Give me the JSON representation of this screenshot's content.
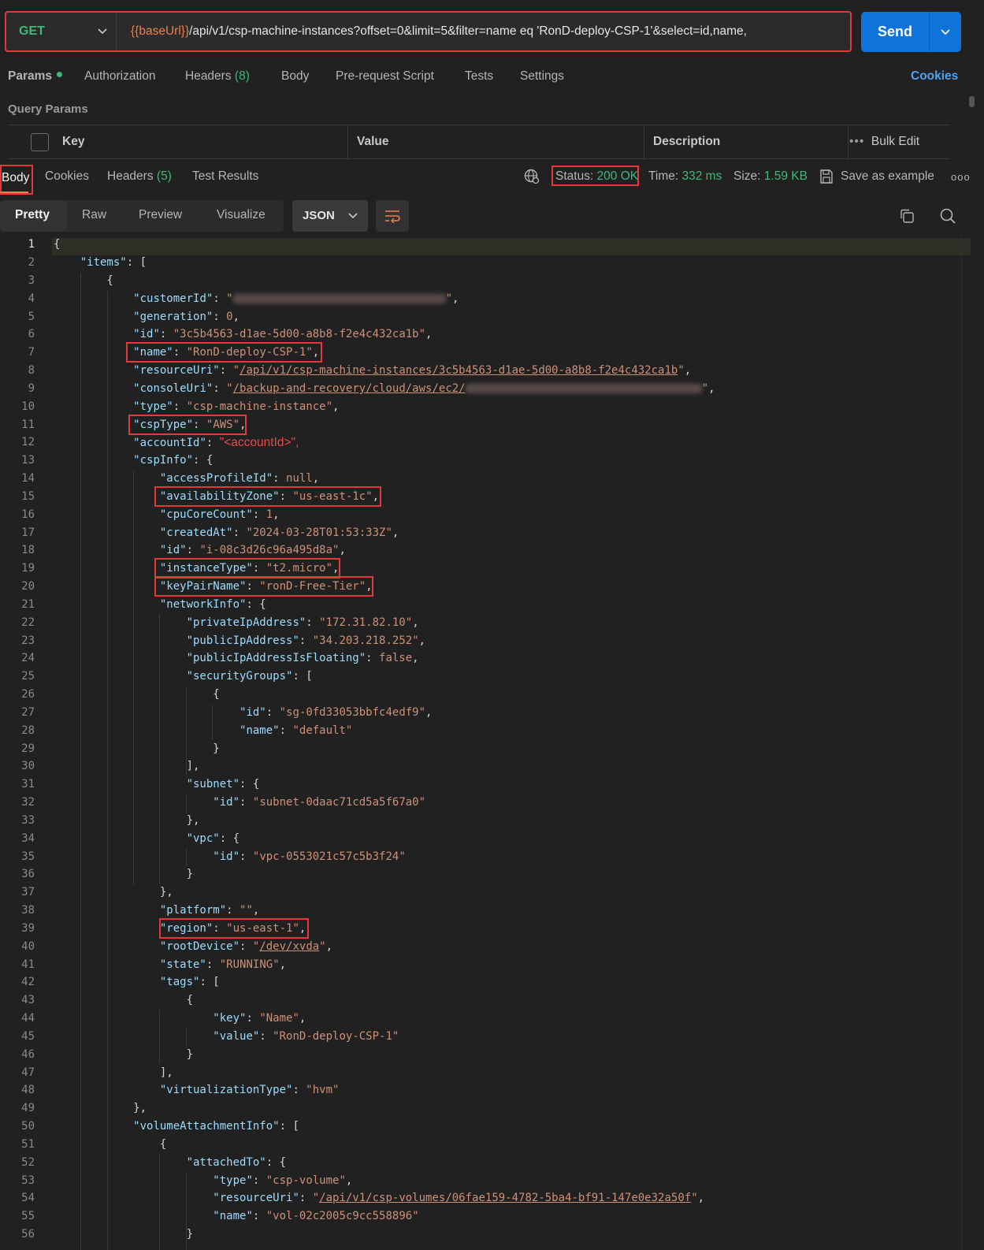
{
  "request": {
    "method": "GET",
    "url_var": "{{baseUrl}}",
    "url_rest": "/api/v1/csp-machine-instances?offset=0&limit=5&filter=name eq 'RonD-deploy-CSP-1'&select=id,name,",
    "send_label": "Send"
  },
  "req_tabs": {
    "params": "Params",
    "authorization": "Authorization",
    "headers": "Headers",
    "headers_count": "(8)",
    "body": "Body",
    "prerequest": "Pre-request Script",
    "tests": "Tests",
    "settings": "Settings",
    "cookies": "Cookies"
  },
  "query_params": {
    "title": "Query Params",
    "col_key": "Key",
    "col_value": "Value",
    "col_description": "Description",
    "bulk_edit": "Bulk Edit"
  },
  "response": {
    "body": "Body",
    "cookies": "Cookies",
    "headers": "Headers",
    "headers_count": "(5)",
    "test_results": "Test Results",
    "status_label": "Status:",
    "status_value": "200 OK",
    "time_label": "Time:",
    "time_value": "332 ms",
    "size_label": "Size:",
    "size_value": "1.59 KB",
    "save_example": "Save as example"
  },
  "view": {
    "pretty": "Pretty",
    "raw": "Raw",
    "preview": "Preview",
    "visualize": "Visualize",
    "format": "JSON"
  },
  "code": {
    "id": "3c5b4563-d1ae-5d00-a8b8-f2e4c432ca1b",
    "name": "RonD-deploy-CSP-1",
    "resourceUri": "/api/v1/csp-machine-instances/3c5b4563-d1ae-5d00-a8b8-f2e4c432ca1b",
    "consoleUri": "/backup-and-recovery/cloud/aws/ec2/",
    "type": "csp-machine-instance",
    "cspType": "AWS",
    "accountId": "\"<accountId>\",",
    "availabilityZone": "us-east-1c",
    "createdAt": "2024-03-28T01:53:33Z",
    "instanceId": "i-08c3d26c96a495d8a",
    "instanceType": "t2.micro",
    "keyPairName": "ronD-Free-Tier",
    "privateIpAddress": "172.31.82.10",
    "publicIpAddress": "34.203.218.252",
    "sgId": "sg-0fd33053bbfc4edf9",
    "sgName": "default",
    "subnetId": "subnet-0daac71cd5a5f67a0",
    "vpcId": "vpc-0553021c57c5b3f24",
    "region": "us-east-1",
    "rootDevice": "/dev/xvda",
    "state": "RUNNING",
    "tagKey": "Name",
    "tagValue": "RonD-deploy-CSP-1",
    "virtualizationType": "hvm",
    "volType": "csp-volume",
    "volUri": "/api/v1/csp-volumes/06fae159-4782-5ba4-bf91-147e0e32a50f",
    "volName": "vol-02c2005c9cc558896"
  }
}
